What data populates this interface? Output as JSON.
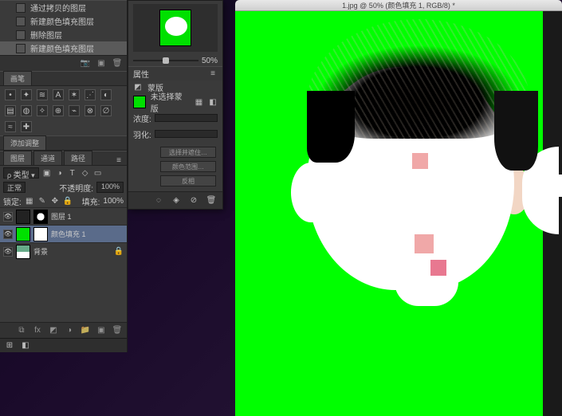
{
  "document": {
    "title": "1.jpg @ 50% (颜色填充 1, RGB/8) *"
  },
  "navigator": {
    "zoom_label": "50%"
  },
  "history": {
    "items": [
      {
        "label": "通过拷贝的图层"
      },
      {
        "label": "新建颜色填充图层"
      },
      {
        "label": "删除图层"
      },
      {
        "label": "新建颜色填充图层"
      }
    ],
    "selected_index": 3
  },
  "brushes": {
    "tab": "画笔"
  },
  "add_panel": {
    "tab": "添加调整"
  },
  "properties": {
    "tab": "属性",
    "type_label": "蒙版",
    "mask_label": "未选择蒙版",
    "density_label": "浓度:",
    "feather_label": "羽化:",
    "buttons": {
      "select": "选择并遮住…",
      "range": "颜色范围…",
      "invert": "反相"
    }
  },
  "layers": {
    "tabs": [
      "图层",
      "通道",
      "路径"
    ],
    "active_tab": 0,
    "kind_label": "类型",
    "blend_mode": "正常",
    "opacity_label": "不透明度:",
    "opacity_value": "100%",
    "lock_label": "锁定:",
    "fill_label": "填充:",
    "fill_value": "100%",
    "items": [
      {
        "name": "图层 1"
      },
      {
        "name": "颜色填充 1"
      },
      {
        "name": "背景"
      }
    ],
    "selected_index": 1
  },
  "icons": {
    "menu": "≡",
    "chain": "⧉",
    "trash": "🗑",
    "new": "▣",
    "folder": "📁",
    "fx": "fx",
    "mask": "◩",
    "adj": "◑",
    "eye": "👁"
  }
}
